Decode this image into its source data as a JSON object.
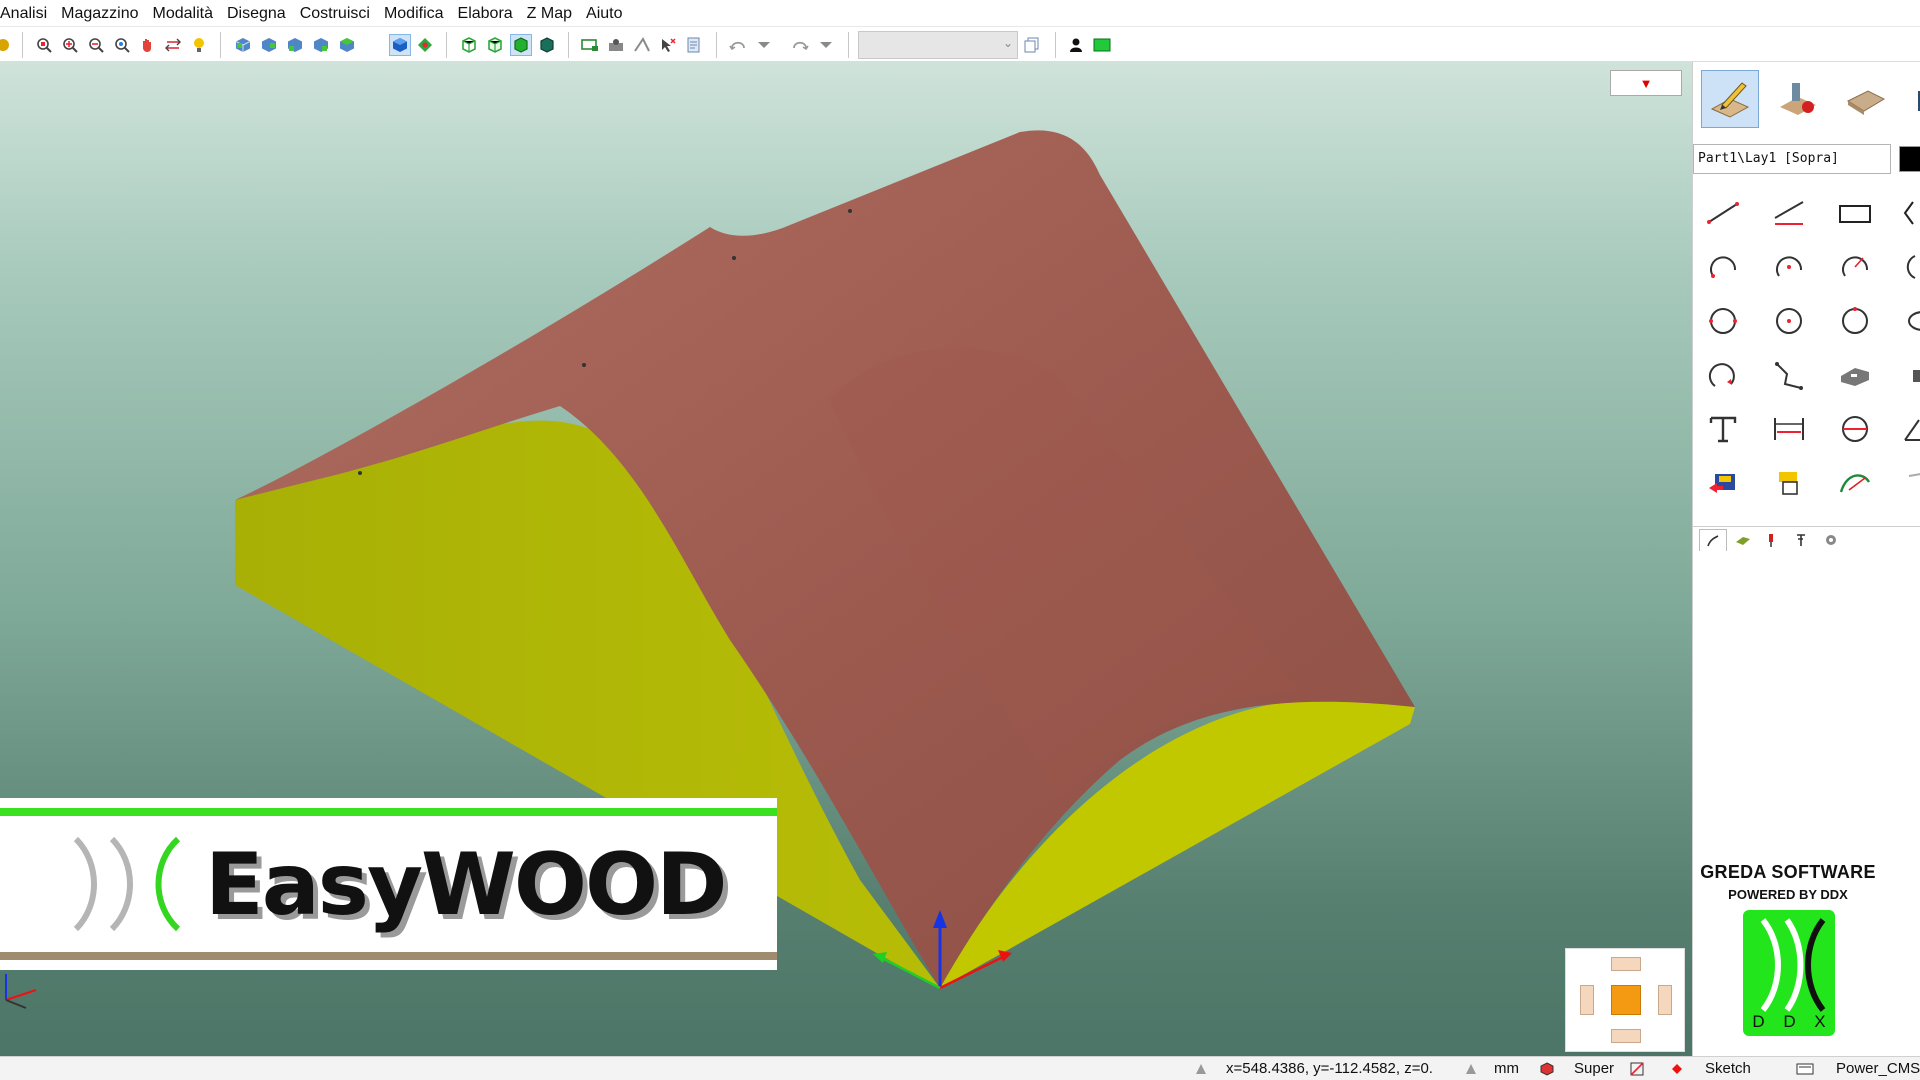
{
  "menu": {
    "items": [
      "Analisi",
      "Magazzino",
      "Modalità",
      "Disegna",
      "Costruisci",
      "Modifica",
      "Elabora",
      "Z Map",
      "Aiuto"
    ]
  },
  "toolbar": {
    "combo_value": "",
    "active_view": "iso-view-blue-icon"
  },
  "viewport": {
    "view_menu_arrow": "▼",
    "colors": {
      "top_surface": "#9e5b50",
      "side_surface": "#b6bb0a",
      "background_top": "#cfe3da",
      "background_bottom": "#4d7567"
    }
  },
  "banner": {
    "brand": "EasyWOOD",
    "stripe_top_color": "#3be01e",
    "stripe_bottom_color": "#a08b6e"
  },
  "right_panel": {
    "layer": "Part1\\Lay1 [Sopra]",
    "greda_title": "GREDA SOFTWARE",
    "greda_subtitle": "POWERED BY DDX",
    "ddx_letters": [
      "D",
      "D",
      "X"
    ]
  },
  "status": {
    "coords": "x=548.4386, y=-112.4582, z=0.",
    "units": "mm",
    "mode": "Super",
    "sketch": "Sketch",
    "machine": "Power_CMS"
  }
}
